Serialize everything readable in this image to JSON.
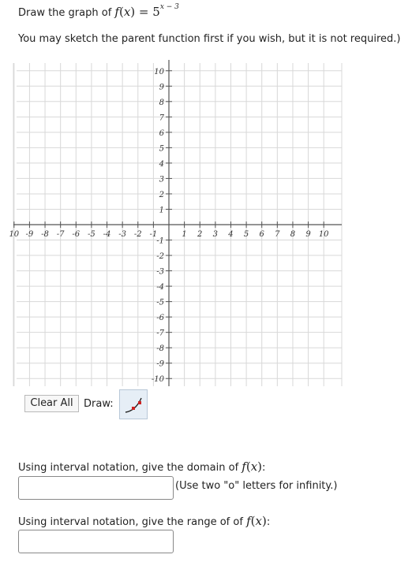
{
  "question": {
    "prompt_prefix": "Draw the graph of ",
    "func": "f",
    "var": "x",
    "base": "5",
    "exponent": "x − 3",
    "hint": "You may sketch the parent function first if you wish, but it is not required.)"
  },
  "graph": {
    "x_ticks": [
      "10",
      "-9",
      "-8",
      "-7",
      "-6",
      "-5",
      "-4",
      "-3",
      "-2",
      "-1",
      "1",
      "2",
      "3",
      "4",
      "5",
      "6",
      "7",
      "8",
      "9",
      "10"
    ],
    "y_ticks": [
      "10",
      "9",
      "8",
      "7",
      "6",
      "5",
      "4",
      "3",
      "2",
      "1",
      "-1",
      "-2",
      "-3",
      "-4",
      "-5",
      "-6",
      "-7",
      "-8",
      "-9",
      "-10"
    ],
    "x_range": [
      -10,
      10
    ],
    "y_range": [
      -10,
      10
    ],
    "grid": true
  },
  "controls": {
    "clear_all_label": "Clear All",
    "draw_label": "Draw:",
    "draw_tool_icon": "exponential-curve-icon"
  },
  "domain_question": {
    "text": "Using interval notation, give the domain of ",
    "suffix": ":",
    "value": "",
    "note": "(Use two \"o\" letters for infinity.)"
  },
  "range_question": {
    "text": "Using interval notation, give the range of of ",
    "suffix": ":",
    "value": ""
  },
  "colors": {
    "grid_line": "#d8d8d8",
    "axis": "#555555",
    "tool_bg": "#e6eef6",
    "curve_icon": "#222222",
    "point_icon": "#cc2222"
  }
}
